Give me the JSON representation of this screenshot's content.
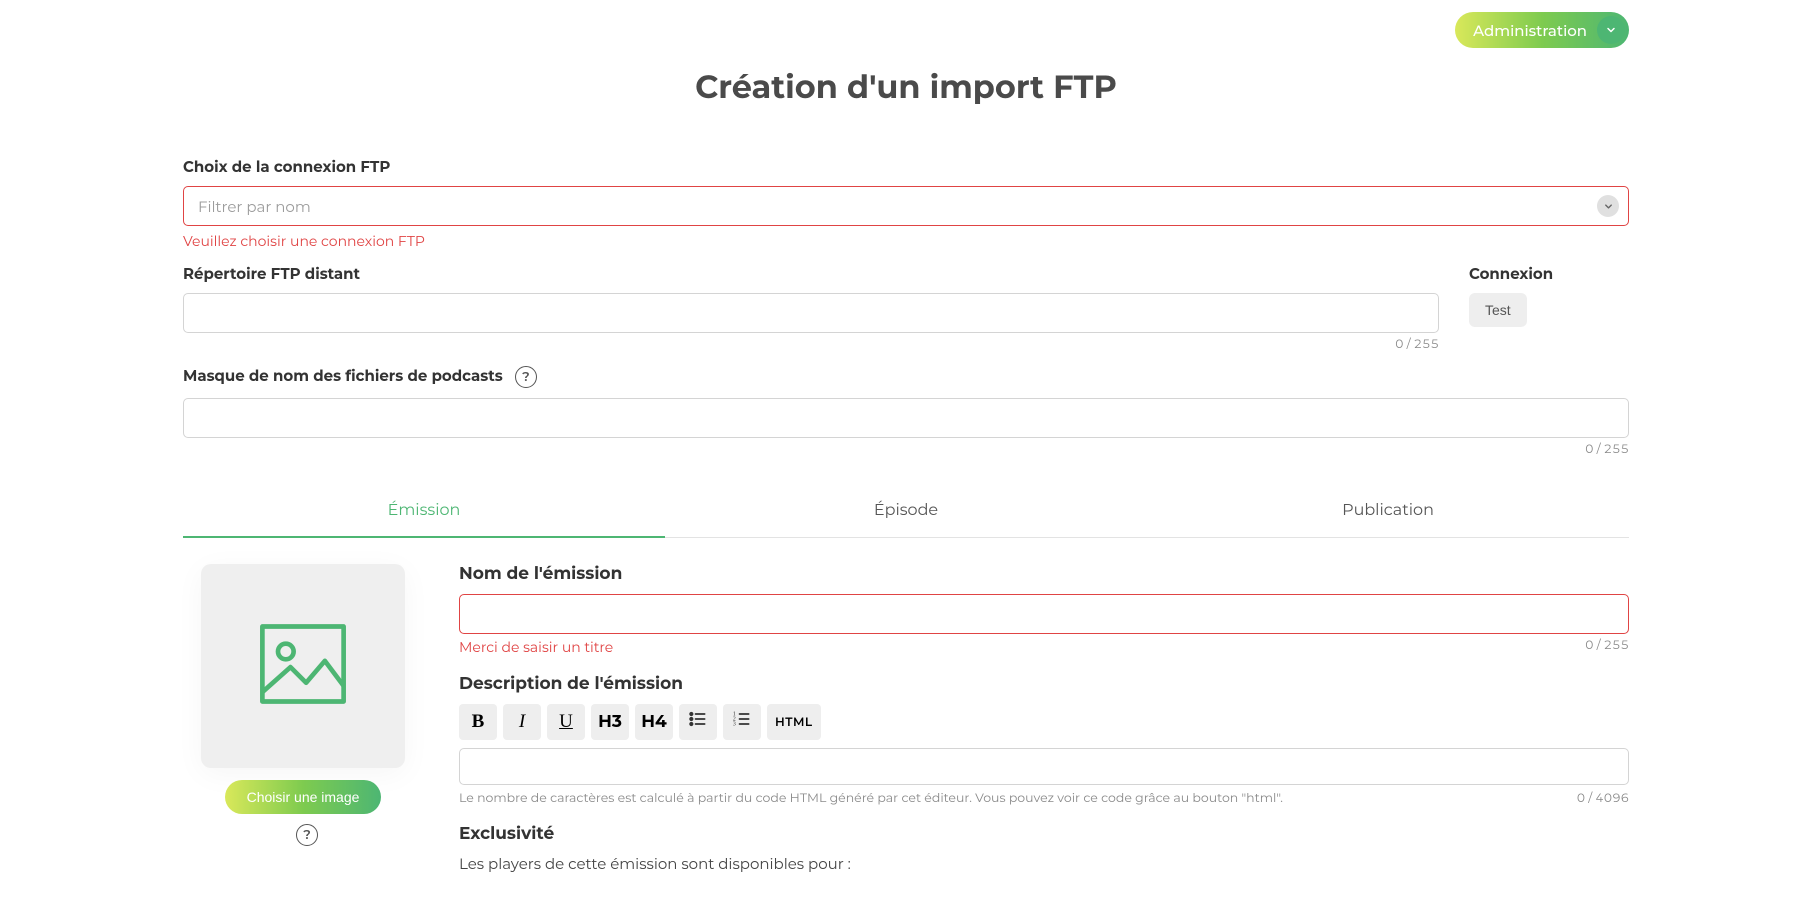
{
  "header": {
    "admin_label": "Administration"
  },
  "page": {
    "title": "Création d'un import FTP"
  },
  "ftp": {
    "connection_label": "Choix de la connexion FTP",
    "connection_placeholder": "Filtrer par nom",
    "connection_error": "Veuillez choisir une connexion FTP",
    "remote_dir_label": "Répertoire FTP distant",
    "remote_dir_value": "",
    "remote_dir_counter": "0 / 255",
    "test_section_label": "Connexion",
    "test_button": "Test",
    "mask_label": "Masque de nom des fichiers de podcasts",
    "mask_value": "",
    "mask_counter": "0 / 255"
  },
  "tabs": [
    {
      "label": "Émission",
      "active": true
    },
    {
      "label": "Épisode",
      "active": false
    },
    {
      "label": "Publication",
      "active": false
    }
  ],
  "emission": {
    "choose_image": "Choisir une image",
    "name_label": "Nom de l'émission",
    "name_value": "",
    "name_error": "Merci de saisir un titre",
    "name_counter": "0 / 255",
    "desc_label": "Description de l'émission",
    "desc_value": "",
    "desc_info": "Le nombre de caractères est calculé à partir du code HTML généré par cet éditeur. Vous pouvez voir ce code grâce au bouton \"html\".",
    "desc_counter": "0 / 4096",
    "exclusivity_label": "Exclusivité",
    "exclusivity_text": "Les players de cette émission sont disponibles pour :",
    "toolbar": {
      "bold": "B",
      "italic": "I",
      "underline": "U",
      "h3": "H3",
      "h4": "H4",
      "html": "HTML"
    }
  }
}
